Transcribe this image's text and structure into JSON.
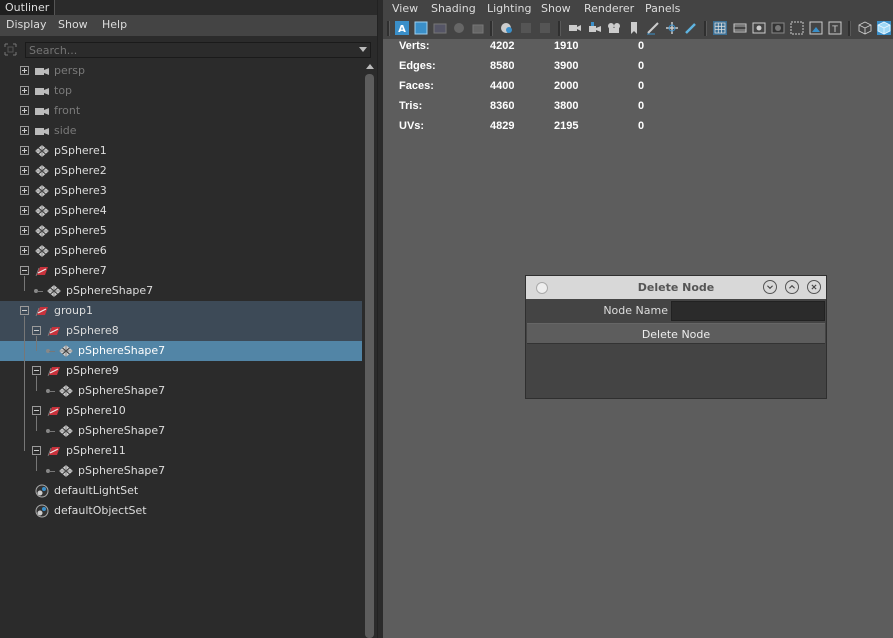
{
  "outliner": {
    "tab": "Outliner",
    "menu": [
      "Display",
      "Show",
      "Help"
    ],
    "search_placeholder": "Search...",
    "items": [
      {
        "label": "persp",
        "depth": 0,
        "icon": "camera-icon",
        "expander": "plus",
        "dim": true
      },
      {
        "label": "top",
        "depth": 0,
        "icon": "camera-icon",
        "expander": "plus",
        "dim": true
      },
      {
        "label": "front",
        "depth": 0,
        "icon": "camera-icon",
        "expander": "plus",
        "dim": true
      },
      {
        "label": "side",
        "depth": 0,
        "icon": "camera-icon",
        "expander": "plus",
        "dim": true
      },
      {
        "label": "pSphere1",
        "depth": 0,
        "icon": "mesh-icon",
        "expander": "plus"
      },
      {
        "label": "pSphere2",
        "depth": 0,
        "icon": "mesh-icon",
        "expander": "plus"
      },
      {
        "label": "pSphere3",
        "depth": 0,
        "icon": "mesh-icon",
        "expander": "plus"
      },
      {
        "label": "pSphere4",
        "depth": 0,
        "icon": "mesh-icon",
        "expander": "plus"
      },
      {
        "label": "pSphere5",
        "depth": 0,
        "icon": "mesh-icon",
        "expander": "plus"
      },
      {
        "label": "pSphere6",
        "depth": 0,
        "icon": "mesh-icon",
        "expander": "plus"
      },
      {
        "label": "pSphere7",
        "depth": 0,
        "icon": "transform-icon",
        "expander": "minus"
      },
      {
        "label": "pSphereShape7",
        "depth": 1,
        "icon": "mesh-icon",
        "expander": "dot"
      },
      {
        "label": "group1",
        "depth": 0,
        "icon": "transform-icon",
        "expander": "minus",
        "group": true
      },
      {
        "label": "pSphere8",
        "depth": 1,
        "icon": "transform-icon",
        "expander": "minus",
        "group": true
      },
      {
        "label": "pSphereShape7",
        "depth": 2,
        "icon": "mesh-icon",
        "expander": "dot",
        "selected": true
      },
      {
        "label": "pSphere9",
        "depth": 1,
        "icon": "transform-icon",
        "expander": "minus"
      },
      {
        "label": "pSphereShape7",
        "depth": 2,
        "icon": "mesh-icon",
        "expander": "dot"
      },
      {
        "label": "pSphere10",
        "depth": 1,
        "icon": "transform-icon",
        "expander": "minus"
      },
      {
        "label": "pSphereShape7",
        "depth": 2,
        "icon": "mesh-icon",
        "expander": "dot"
      },
      {
        "label": "pSphere11",
        "depth": 1,
        "icon": "transform-icon",
        "expander": "minus"
      },
      {
        "label": "pSphereShape7",
        "depth": 2,
        "icon": "mesh-icon",
        "expander": "dot"
      },
      {
        "label": "defaultLightSet",
        "depth": 0,
        "icon": "set-icon",
        "expander": "none"
      },
      {
        "label": "defaultObjectSet",
        "depth": 0,
        "icon": "set-icon",
        "expander": "none"
      }
    ]
  },
  "viewport": {
    "menu": [
      "View",
      "Shading",
      "Lighting",
      "Show",
      "Renderer",
      "Panels"
    ],
    "hud": [
      {
        "label": "Verts:",
        "values": [
          "4202",
          "1910",
          "0"
        ]
      },
      {
        "label": "Edges:",
        "values": [
          "8580",
          "3900",
          "0"
        ]
      },
      {
        "label": "Faces:",
        "values": [
          "4400",
          "2000",
          "0"
        ]
      },
      {
        "label": "Tris:",
        "values": [
          "8360",
          "3800",
          "0"
        ]
      },
      {
        "label": "UVs:",
        "values": [
          "4829",
          "2195",
          "0"
        ]
      }
    ]
  },
  "dialog": {
    "title": "Delete Node",
    "field_label": "Node Name",
    "field_value": "",
    "button_label": "Delete Node"
  },
  "colors": {
    "selection": "#5285a6",
    "group_highlight": "#3d4a57",
    "transform_icon": "#c8323c"
  }
}
